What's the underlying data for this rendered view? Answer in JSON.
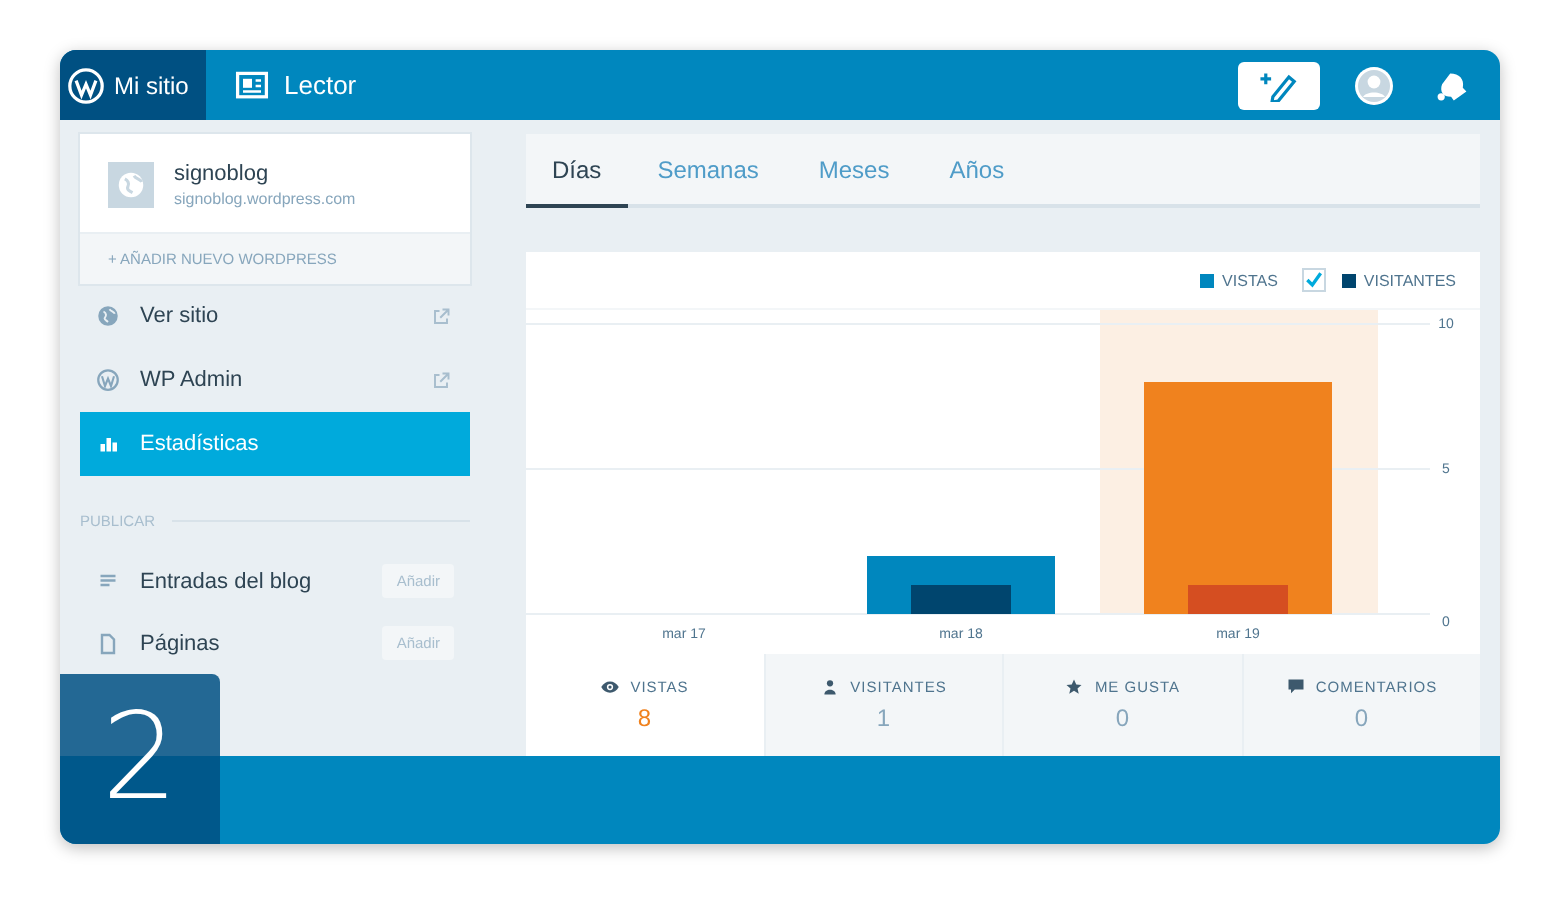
{
  "topbar": {
    "tabs": [
      {
        "label": "Mi sitio",
        "selected": true
      },
      {
        "label": "Lector",
        "selected": false
      }
    ]
  },
  "sidebar": {
    "site": {
      "name": "signoblog",
      "url": "signoblog.wordpress.com",
      "add_label": "+ AÑADIR NUEVO WORDPRESS"
    },
    "items": [
      {
        "label": "Ver sitio",
        "external": true,
        "selected": false
      },
      {
        "label": "WP Admin",
        "external": true,
        "selected": false
      },
      {
        "label": "Estadísticas",
        "external": false,
        "selected": true
      }
    ],
    "sections": [
      {
        "title": "PUBLICAR",
        "items": [
          {
            "label": "Entradas del blog",
            "action": "Añadir"
          },
          {
            "label": "Páginas",
            "action": "Añadir"
          }
        ]
      }
    ]
  },
  "stats": {
    "period_tabs": [
      {
        "label": "Días",
        "selected": true
      },
      {
        "label": "Semanas",
        "selected": false
      },
      {
        "label": "Meses",
        "selected": false
      },
      {
        "label": "Años",
        "selected": false
      }
    ],
    "legend_checkbox": {
      "checked": true
    },
    "selected_bars": [
      false,
      false,
      true
    ],
    "chart_data": {
      "type": "bar",
      "categories": [
        "mar 17",
        "mar 18",
        "mar 19"
      ],
      "series": [
        {
          "name": "VISTAS",
          "color": "#0087be",
          "values": [
            0,
            2,
            null
          ]
        },
        {
          "name": "VISITANTES",
          "color": "#00456e",
          "values": [
            0,
            1,
            null
          ]
        },
        {
          "color": "#f0821e",
          "values": [
            null,
            null,
            8
          ]
        },
        {
          "color": "#d54e21",
          "values": [
            null,
            null,
            1
          ]
        }
      ],
      "ylim": [
        0,
        10
      ],
      "yticks": [
        0,
        5,
        10
      ]
    },
    "summary": [
      {
        "label": "VISTAS",
        "value": "8",
        "selected": true
      },
      {
        "label": "VISITANTES",
        "value": "1",
        "selected": false
      },
      {
        "label": "ME GUSTA",
        "value": "0",
        "selected": false
      },
      {
        "label": "COMENTARIOS",
        "value": "0",
        "selected": false
      }
    ]
  },
  "badge": "2"
}
